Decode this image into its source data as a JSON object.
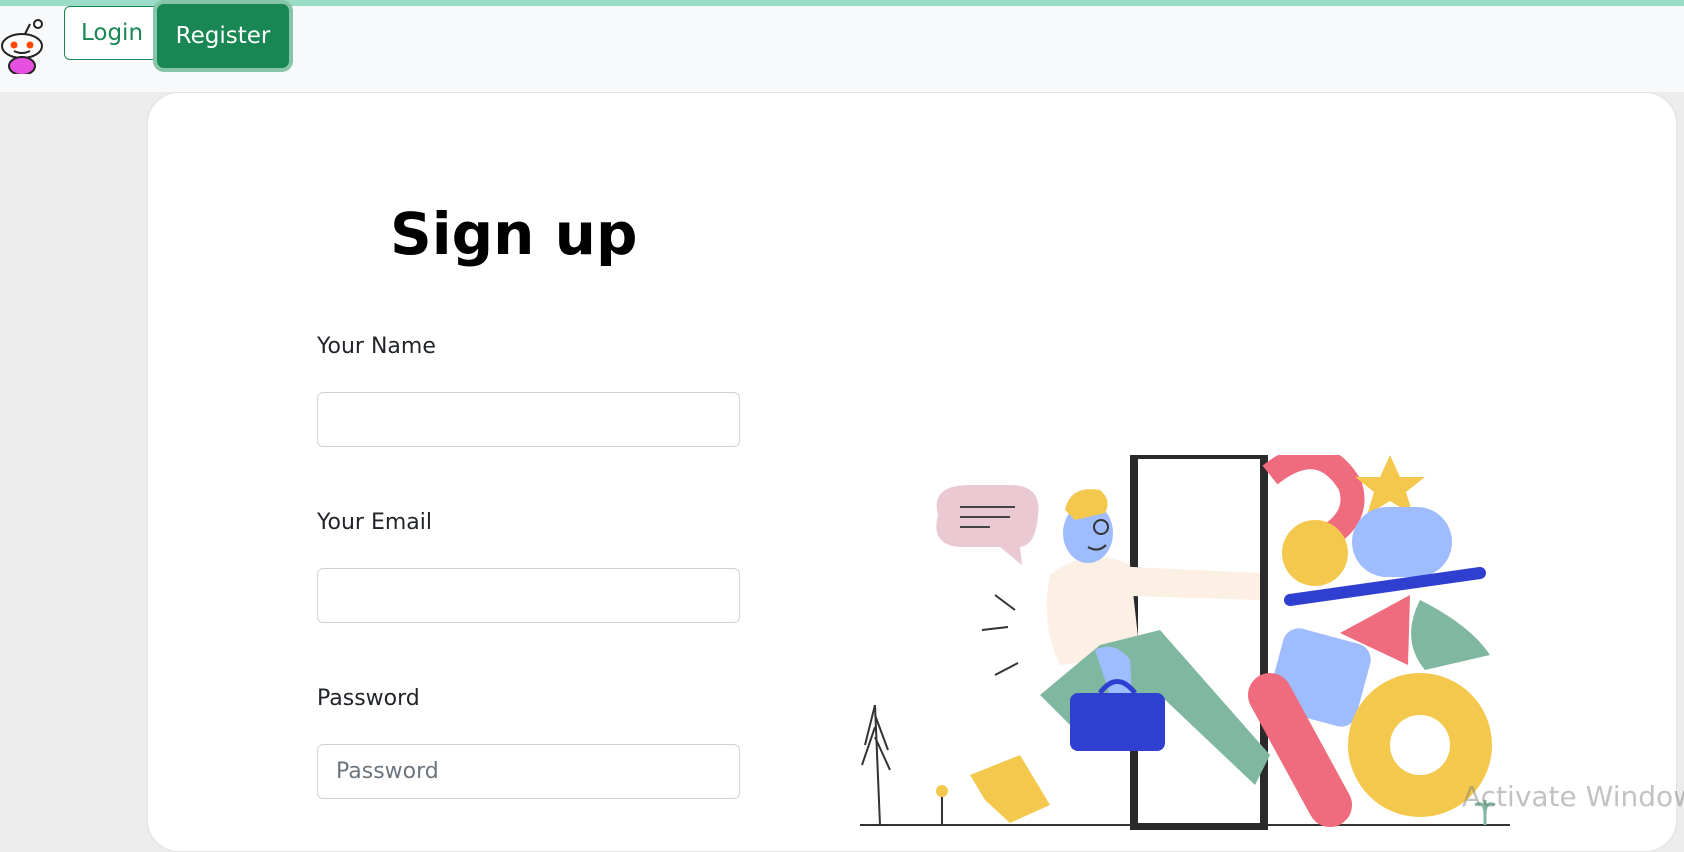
{
  "navbar": {
    "login_label": "Login",
    "register_label": "Register",
    "accent_color": "#198754"
  },
  "form": {
    "title": "Sign up",
    "name_label": "Your Name",
    "name_value": "",
    "email_label": "Your Email",
    "email_value": "",
    "password_label": "Password",
    "password_placeholder": "Password"
  },
  "overlay": {
    "watermark": "Activate Window"
  },
  "icons": {
    "logo": "reddit-alien-icon",
    "illustration": "person-leaving-door-with-shapes"
  }
}
